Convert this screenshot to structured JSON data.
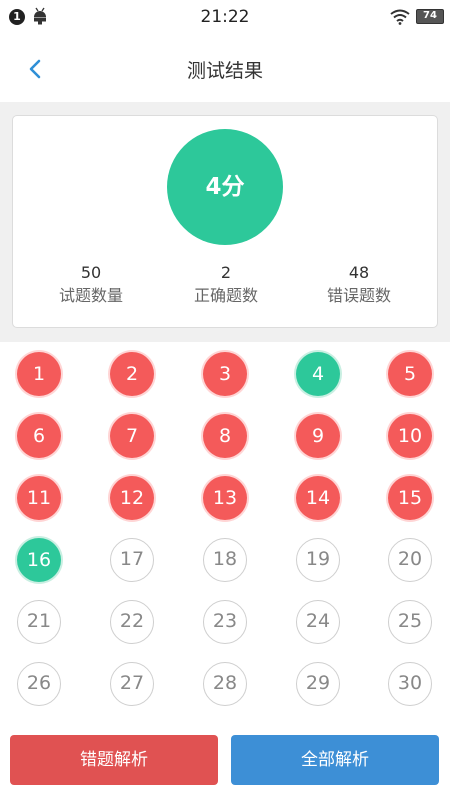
{
  "status_bar": {
    "notification_count": "1",
    "time": "21:22",
    "battery": "74"
  },
  "nav": {
    "title": "测试结果"
  },
  "score": {
    "value": "4分",
    "color": "#2dc89a"
  },
  "stats": [
    {
      "value": "50",
      "label": "试题数量"
    },
    {
      "value": "2",
      "label": "正确题数"
    },
    {
      "value": "48",
      "label": "错误题数"
    }
  ],
  "colors": {
    "wrong": "#f45a5a",
    "correct": "#2dc89a",
    "accent_blue": "#3d8fd6"
  },
  "questions": [
    {
      "num": "1",
      "status": "wrong"
    },
    {
      "num": "2",
      "status": "wrong"
    },
    {
      "num": "3",
      "status": "wrong"
    },
    {
      "num": "4",
      "status": "correct"
    },
    {
      "num": "5",
      "status": "wrong"
    },
    {
      "num": "6",
      "status": "wrong"
    },
    {
      "num": "7",
      "status": "wrong"
    },
    {
      "num": "8",
      "status": "wrong"
    },
    {
      "num": "9",
      "status": "wrong"
    },
    {
      "num": "10",
      "status": "wrong"
    },
    {
      "num": "11",
      "status": "wrong"
    },
    {
      "num": "12",
      "status": "wrong"
    },
    {
      "num": "13",
      "status": "wrong"
    },
    {
      "num": "14",
      "status": "wrong"
    },
    {
      "num": "15",
      "status": "wrong"
    },
    {
      "num": "16",
      "status": "correct"
    },
    {
      "num": "17",
      "status": "unanswered"
    },
    {
      "num": "18",
      "status": "unanswered"
    },
    {
      "num": "19",
      "status": "unanswered"
    },
    {
      "num": "20",
      "status": "unanswered"
    },
    {
      "num": "21",
      "status": "unanswered"
    },
    {
      "num": "22",
      "status": "unanswered"
    },
    {
      "num": "23",
      "status": "unanswered"
    },
    {
      "num": "24",
      "status": "unanswered"
    },
    {
      "num": "25",
      "status": "unanswered"
    },
    {
      "num": "26",
      "status": "unanswered"
    },
    {
      "num": "27",
      "status": "unanswered"
    },
    {
      "num": "28",
      "status": "unanswered"
    },
    {
      "num": "29",
      "status": "unanswered"
    },
    {
      "num": "30",
      "status": "unanswered"
    }
  ],
  "buttons": {
    "wrong_analysis": "错题解析",
    "all_analysis": "全部解析"
  }
}
